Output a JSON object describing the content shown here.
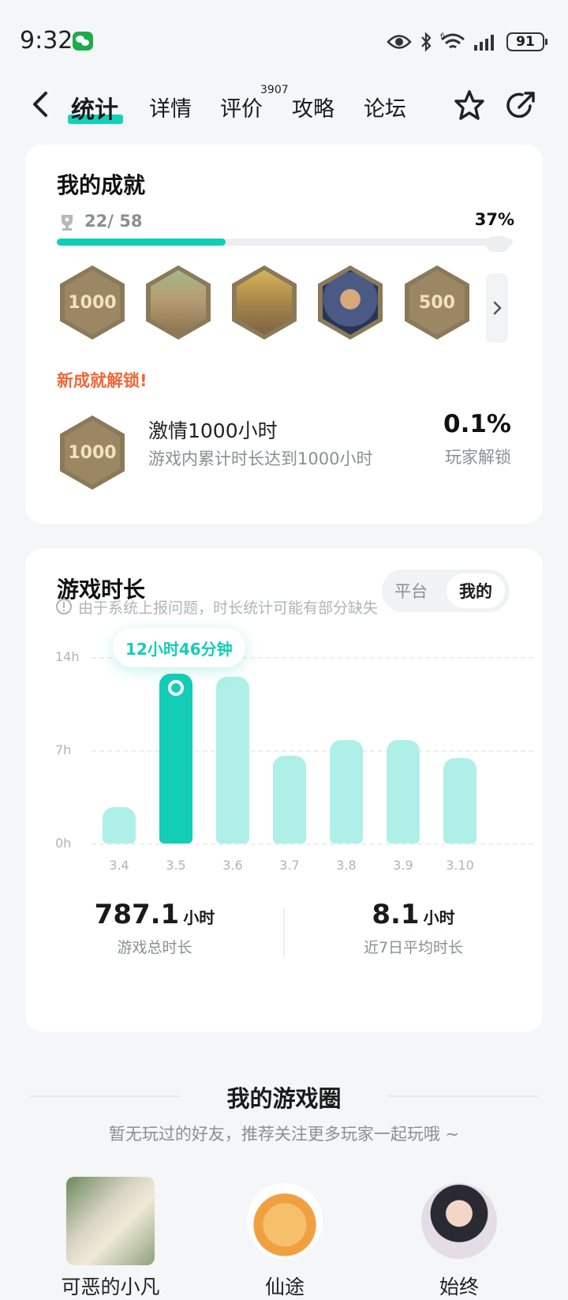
{
  "status_bar": {
    "time": "9:32",
    "battery": "91"
  },
  "nav": {
    "tabs": [
      "统计",
      "详情",
      "评价",
      "攻略",
      "论坛"
    ],
    "review_count": "3907"
  },
  "achievements": {
    "title": "我的成就",
    "progress_text": "22/ 58",
    "percent": "37%",
    "progress_fraction": 0.37,
    "badges": [
      "1000",
      "",
      "",
      "",
      "500"
    ],
    "new_unlock_label": "新成就解锁!",
    "new": {
      "badge": "1000",
      "name": "激情1000小时",
      "desc": "游戏内累计时长达到1000小时",
      "rate": "0.1%",
      "rate_label": "玩家解锁"
    }
  },
  "playtime": {
    "title": "游戏时长",
    "toggle": [
      "平台",
      "我的"
    ],
    "notice": "由于系统上报问题，时长统计可能有部分缺失",
    "tooltip": "12小时46分钟",
    "total_value": "787.1",
    "total_unit": "小时",
    "total_label": "游戏总时长",
    "avg_value": "8.1",
    "avg_unit": "小时",
    "avg_label": "近7日平均时长"
  },
  "chart_data": {
    "type": "bar",
    "categories": [
      "3.4",
      "3.5",
      "3.6",
      "3.7",
      "3.8",
      "3.9",
      "3.10"
    ],
    "values": [
      2.7,
      12.77,
      12.5,
      6.6,
      7.8,
      7.8,
      6.4
    ],
    "yticks": [
      "0h",
      "7h",
      "14h"
    ],
    "ylim": [
      0,
      14
    ],
    "active_index": 1,
    "grid": true
  },
  "circle": {
    "title": "我的游戏圈",
    "subtitle": "暂无玩过的好友，推荐关注更多玩家一起玩哦 ~",
    "friends": [
      "可恶的小凡",
      "仙途",
      "始终"
    ]
  },
  "colors": {
    "accent": "#13cdb6",
    "accent_light": "#aef0e7",
    "orange": "#f0683a"
  }
}
